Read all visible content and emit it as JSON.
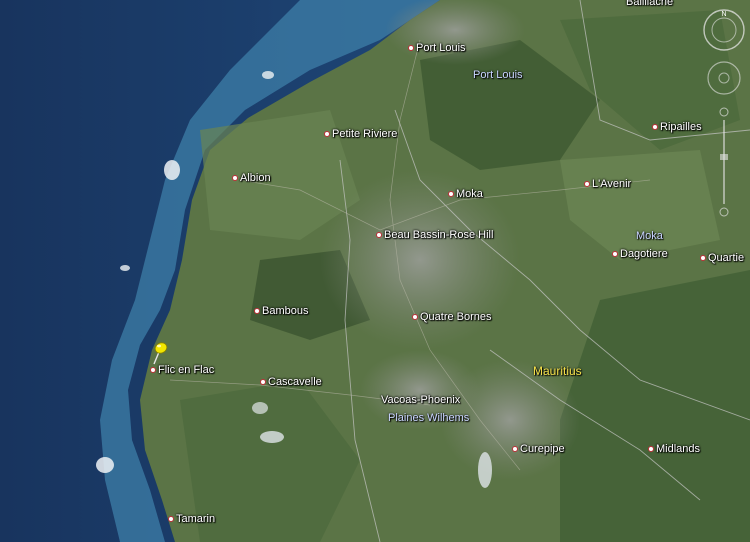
{
  "map": {
    "places": [
      {
        "id": "baillache",
        "name": "Bailliache"
      },
      {
        "id": "port-louis-city",
        "name": "Port Louis"
      },
      {
        "id": "petite-riviere",
        "name": "Petite Riviere"
      },
      {
        "id": "ripailles",
        "name": "Ripailles"
      },
      {
        "id": "albion",
        "name": "Albion"
      },
      {
        "id": "moka",
        "name": "Moka"
      },
      {
        "id": "l-avenir",
        "name": "L'Avenir"
      },
      {
        "id": "beau-bassin",
        "name": "Beau Bassin-Rose Hill"
      },
      {
        "id": "dagotiere",
        "name": "Dagotiere"
      },
      {
        "id": "quartier",
        "name": "Quartie"
      },
      {
        "id": "bambous",
        "name": "Bambous"
      },
      {
        "id": "quatre-bornes",
        "name": "Quatre Bornes"
      },
      {
        "id": "flic-en-flac",
        "name": "Flic en Flac"
      },
      {
        "id": "cascavelle",
        "name": "Cascavelle"
      },
      {
        "id": "vacoas-phoenix",
        "name": "Vacoas-Phoenix"
      },
      {
        "id": "curepipe",
        "name": "Curepipe"
      },
      {
        "id": "midlands",
        "name": "Midlands"
      },
      {
        "id": "tamarin",
        "name": "Tamarin"
      }
    ],
    "districts": [
      {
        "id": "port-louis-district",
        "name": "Port Louis"
      },
      {
        "id": "moka-district",
        "name": "Moka"
      },
      {
        "id": "plaines-wilhems",
        "name": "Plaines Wilhems"
      }
    ],
    "country": "Mauritius",
    "colors": {
      "ocean_deep": "#1c3d6b",
      "ocean_shallow": "#3d7fa8",
      "land": "#5b7446",
      "urban": "#8a8f86",
      "country_label": "#f5e04a",
      "district_label": "#c9d4ff",
      "pin": "#f2e600"
    },
    "icons": [
      "pushpin-icon",
      "compass-icon",
      "look-joystick-icon",
      "zoom-slider-icon"
    ]
  }
}
